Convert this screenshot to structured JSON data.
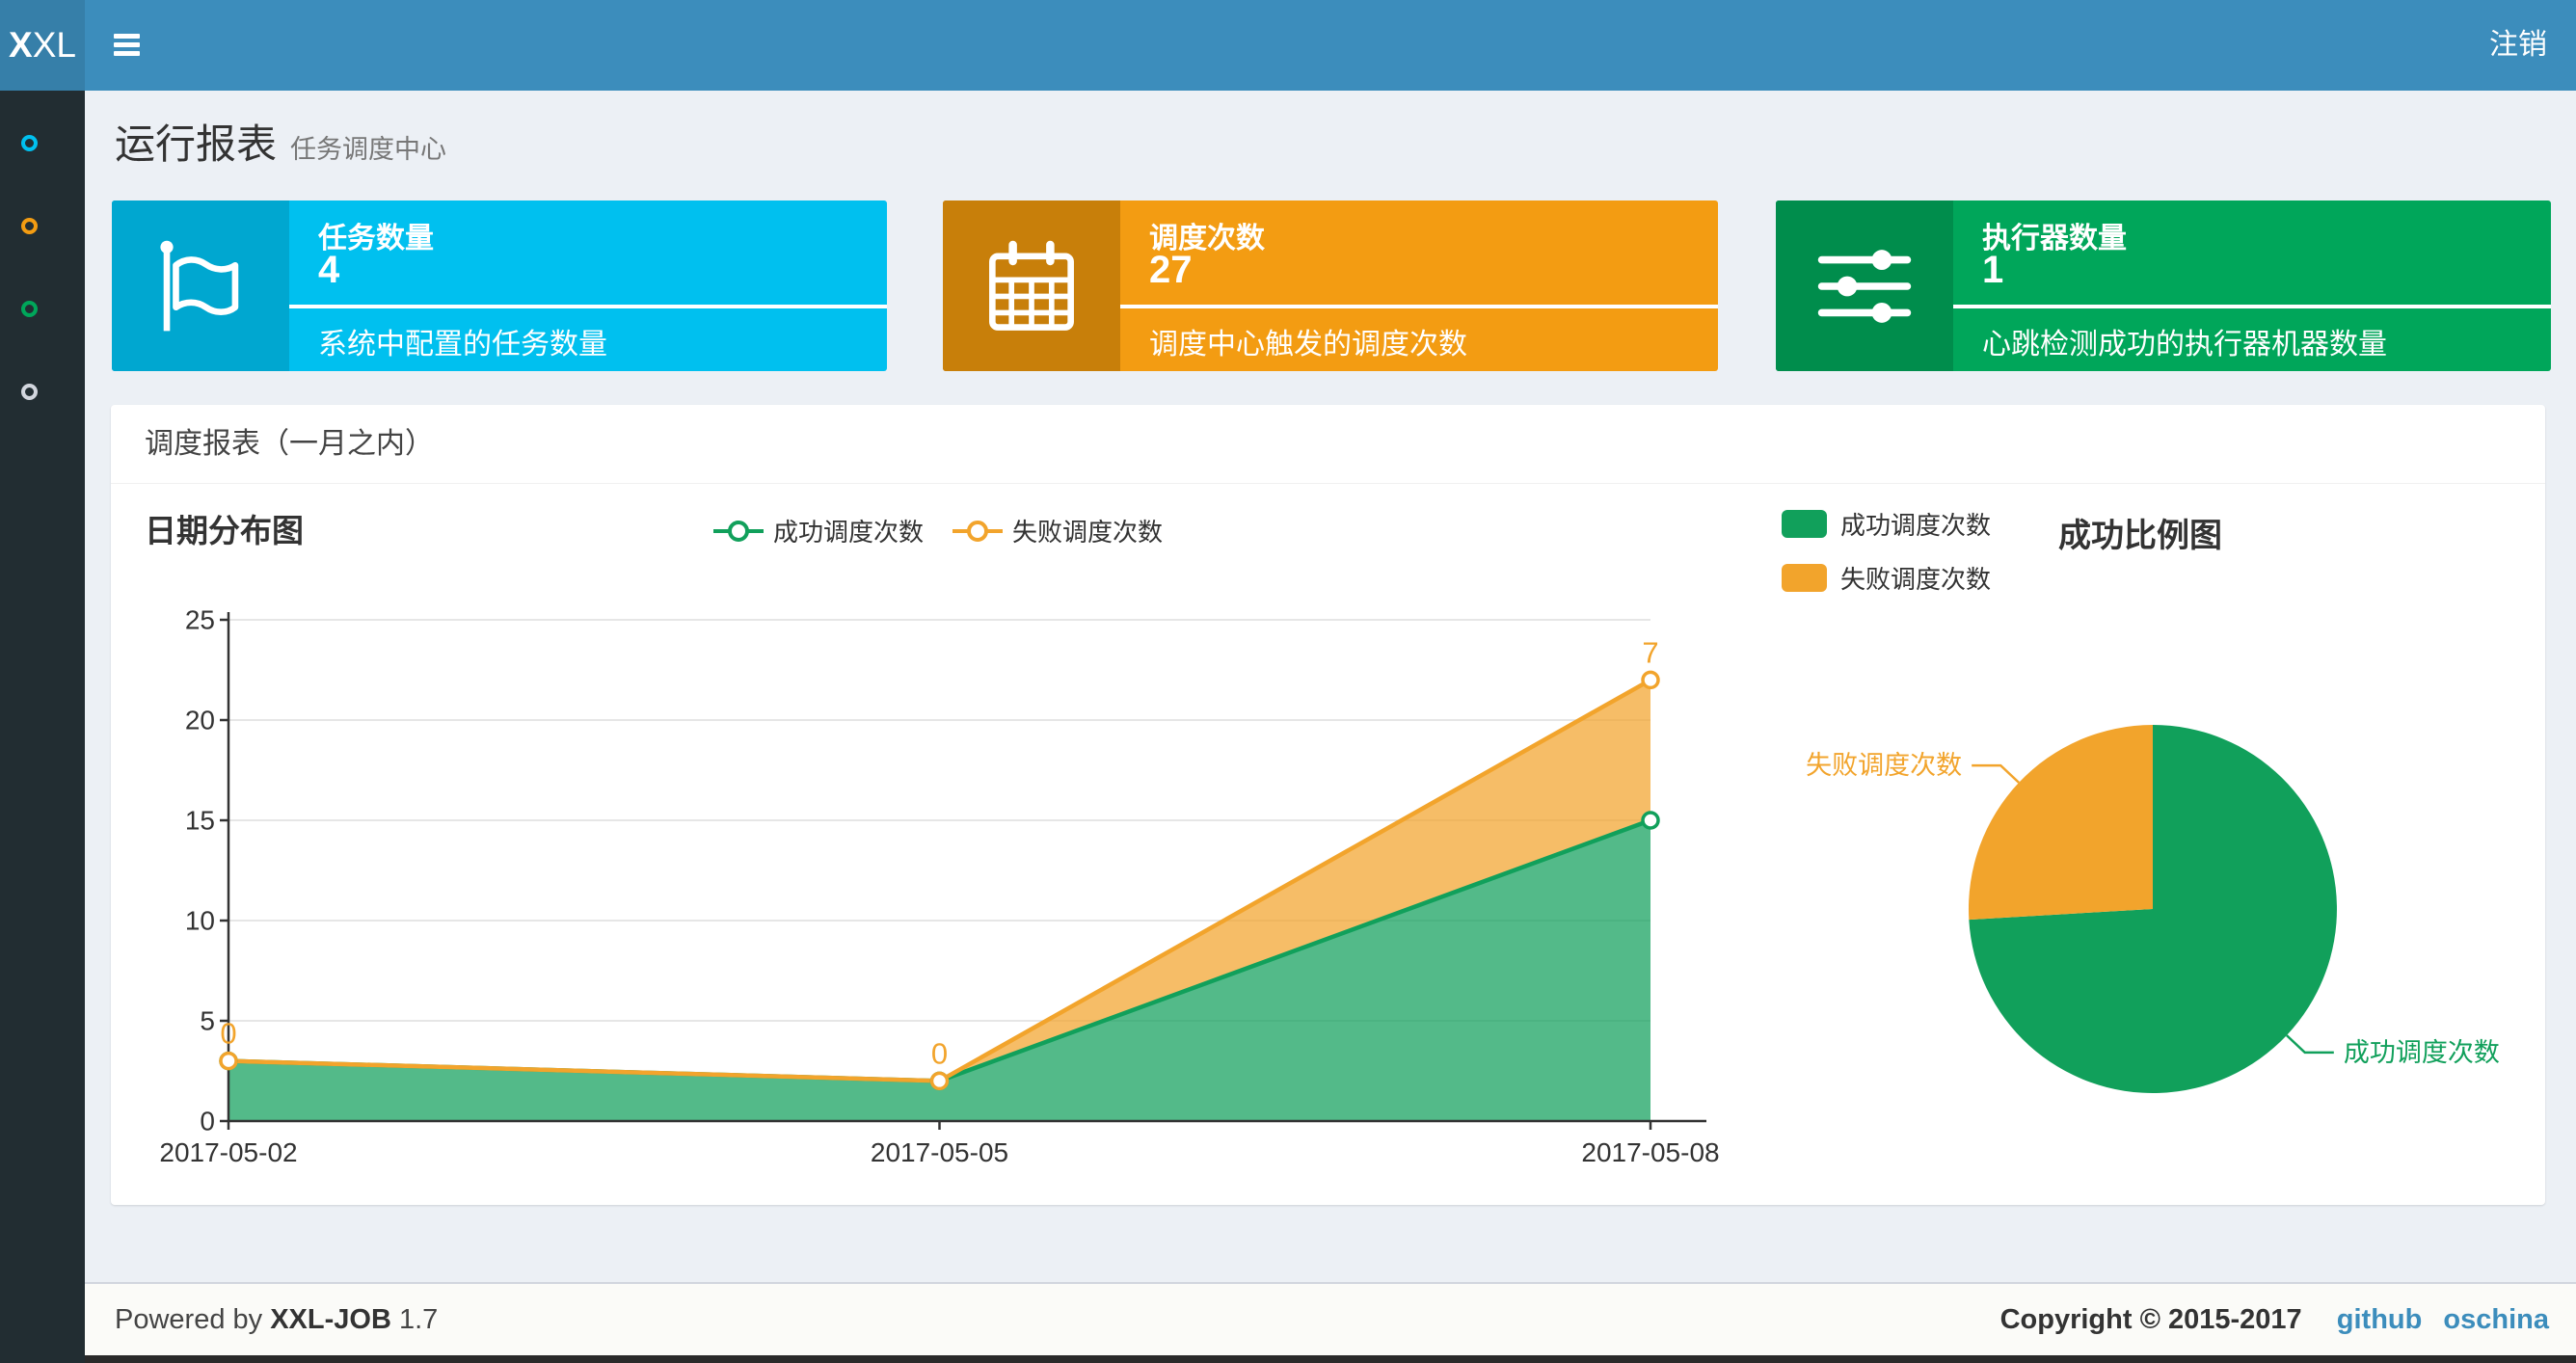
{
  "navbar": {
    "logo_bold": "X",
    "logo_light": "XL",
    "logout": "注销"
  },
  "theme": {
    "navbar_bg": "#3c8dbc",
    "logo_bg": "#367fa9",
    "sidebar_bg": "#222d32",
    "content_bg": "#ecf0f5"
  },
  "sidebar": {
    "items": [
      {
        "name": "report",
        "color": "#00c0ef"
      },
      {
        "name": "job",
        "color": "#f39c12"
      },
      {
        "name": "log",
        "color": "#00a65a"
      },
      {
        "name": "executor",
        "color": "#d2d6de"
      }
    ]
  },
  "header": {
    "title": "运行报表",
    "subtitle": "任务调度中心"
  },
  "info_boxes": [
    {
      "label": "任务数量",
      "value": "4",
      "desc": "系统中配置的任务数量",
      "bg": "#00c0ef",
      "icon_bg": "#00a7d0",
      "icon": "flag-icon"
    },
    {
      "label": "调度次数",
      "value": "27",
      "desc": "调度中心触发的调度次数",
      "bg": "#f39c12",
      "icon_bg": "#c87f0a",
      "icon": "calendar-icon"
    },
    {
      "label": "执行器数量",
      "value": "1",
      "desc": "心跳检测成功的执行器机器数量",
      "bg": "#00a65a",
      "icon_bg": "#008d4c",
      "icon": "sliders-icon"
    }
  ],
  "panel": {
    "title": "调度报表（一月之内）"
  },
  "chart_data": [
    {
      "type": "area",
      "title": "日期分布图",
      "categories": [
        "2017-05-02",
        "2017-05-05",
        "2017-05-08"
      ],
      "stacked": true,
      "series": [
        {
          "name": "成功调度次数",
          "values": [
            3,
            2,
            15
          ],
          "color": "#11a05b",
          "area_opacity": 0.72,
          "show_point_labels": false
        },
        {
          "name": "失败调度次数",
          "values": [
            0,
            0,
            7
          ],
          "color": "#f2a42c",
          "area_opacity": 0.72,
          "show_point_labels": true
        }
      ],
      "xlabel": "",
      "ylabel": "",
      "ylim": [
        0,
        25
      ],
      "yticks": [
        0,
        5,
        10,
        15,
        20,
        25
      ],
      "grid": true,
      "legend_position": "top-center"
    },
    {
      "type": "pie",
      "title": "成功比例图",
      "labels": [
        "成功调度次数",
        "失败调度次数"
      ],
      "values": [
        20,
        7
      ],
      "colors": [
        "#11a05b",
        "#f2a42c"
      ],
      "legend_position": "top-left"
    }
  ],
  "footer": {
    "powered_prefix": "Powered by",
    "product": "XXL-JOB",
    "version": "1.7",
    "copyright": "Copyright © 2015-2017",
    "link_github": "github",
    "link_oschina": "oschina"
  }
}
